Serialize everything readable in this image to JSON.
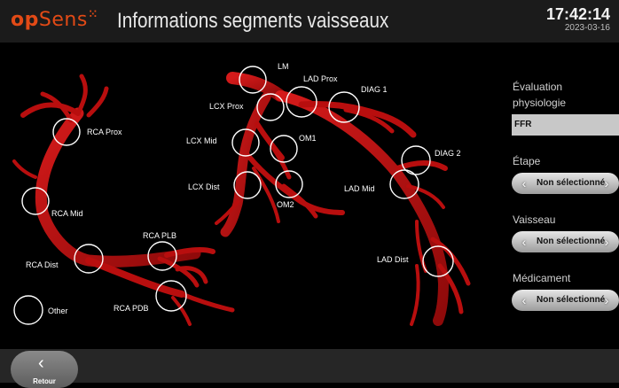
{
  "header": {
    "logo_op": "op",
    "logo_sens": "Sens",
    "title": "Informations segments vaisseaux",
    "time": "17:42:14",
    "date": "2023-03-16"
  },
  "segments": {
    "lm": "LM",
    "lad_prox": "LAD Prox",
    "diag1": "DIAG 1",
    "lcx_prox": "LCX Prox",
    "rca_prox": "RCA Prox",
    "lcx_mid": "LCX Mid",
    "om1": "OM1",
    "diag2": "DIAG 2",
    "lcx_dist": "LCX Dist",
    "lad_mid": "LAD Mid",
    "om2": "OM2",
    "rca_mid": "RCA Mid",
    "rca_plb": "RCA PLB",
    "rca_dist": "RCA Dist",
    "lad_dist": "LAD Dist",
    "other": "Other",
    "rca_pdb": "RCA PDB"
  },
  "side_panel": {
    "evaluation_label_line1": "Évaluation",
    "evaluation_label_line2": "physiologie",
    "evaluation_value": "FFR",
    "etape_label": "Étape",
    "etape_value": "Non sélectionné",
    "vaisseau_label": "Vaisseau",
    "vaisseau_value": "Non sélectionné",
    "medicament_label": "Médicament",
    "medicament_value": "Non sélectionné"
  },
  "footer": {
    "back_label": "Retour"
  },
  "colors": {
    "brand": "#e24a16",
    "vessel": "#b80e0e"
  }
}
